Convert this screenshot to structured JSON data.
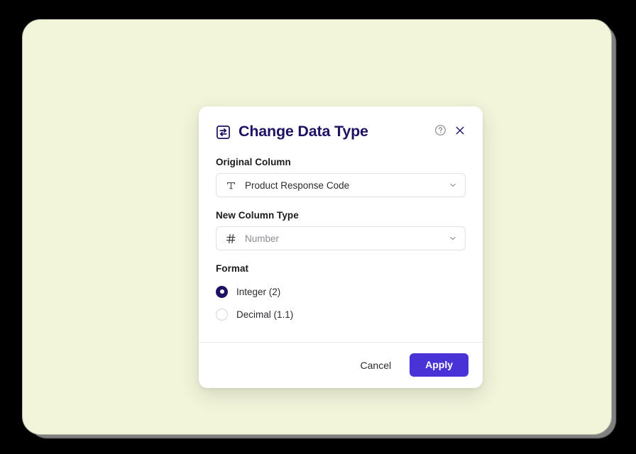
{
  "theme": {
    "canvas_bg": "#f2f5da",
    "dialog_bg": "#ffffff",
    "title_color": "#1f1163",
    "accent": "#4a33d6",
    "radio_selected": "#1f1163",
    "border": "#e2e2e6"
  },
  "dialog": {
    "title": "Change Data Type",
    "title_icon": "swap-arrows-icon",
    "help_icon": "help-circle-icon",
    "close_icon": "close-icon",
    "fields": [
      {
        "label": "Original Column",
        "icon": "text-type-icon",
        "value": "Product Response Code",
        "is_placeholder": false,
        "chevron": "chevron-down-icon"
      },
      {
        "label": "New Column Type",
        "icon": "number-hash-icon",
        "value": "Number",
        "is_placeholder": true,
        "chevron": "chevron-down-icon"
      }
    ],
    "format": {
      "label": "Format",
      "options": [
        {
          "label": "Integer (2)",
          "selected": true
        },
        {
          "label": "Decimal (1.1)",
          "selected": false
        }
      ]
    },
    "footer": {
      "cancel_label": "Cancel",
      "apply_label": "Apply"
    }
  }
}
